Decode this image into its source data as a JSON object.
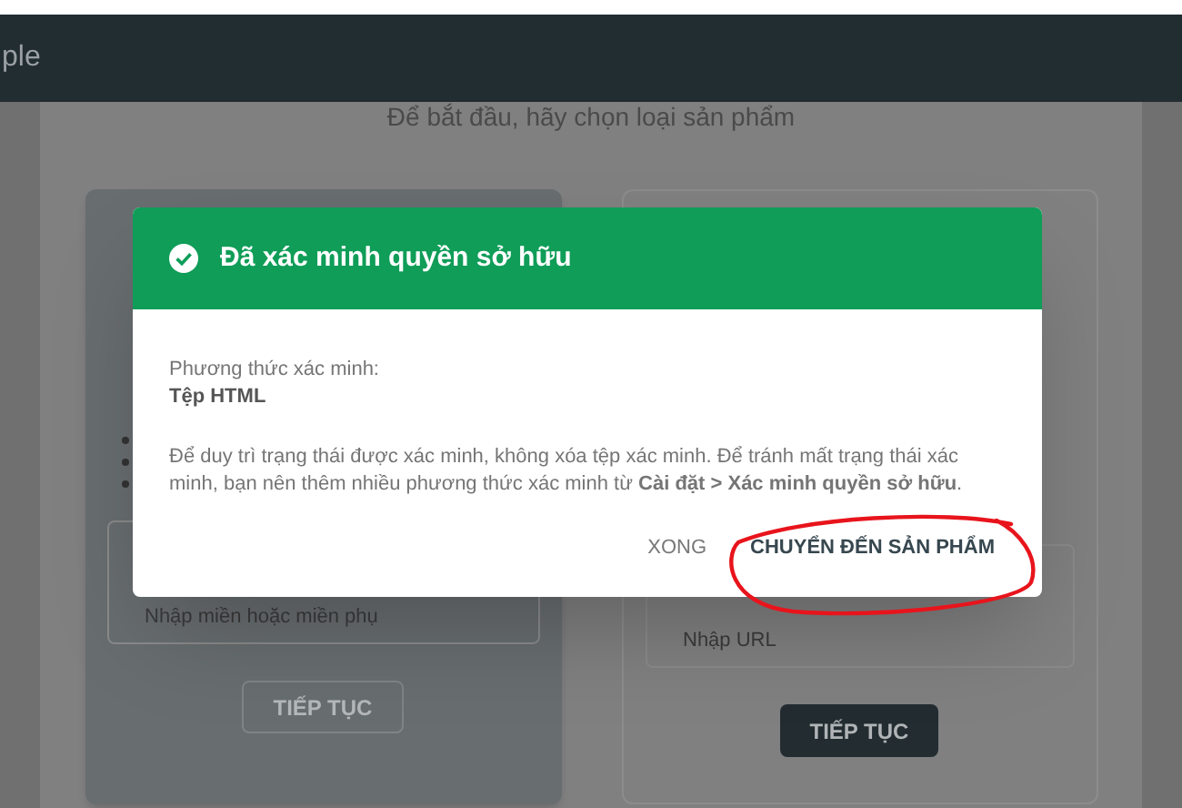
{
  "header": {
    "title": "ple"
  },
  "page": {
    "subtitle": "Để bắt đầu, hãy chọn loại sản phẩm"
  },
  "product_types": [
    {
      "selected": true,
      "placeholder": "Nhập miền hoặc miền phụ",
      "button": "TIẾP TỤC"
    },
    {
      "selected": false,
      "placeholder": "Nhập URL",
      "button": "TIẾP TỤC"
    }
  ],
  "dialog": {
    "title": "Đã xác minh quyền sở hữu",
    "method_label": "Phương thức xác minh:",
    "method": "Tệp HTML",
    "note": "Để duy trì trạng thái được xác minh, không xóa tệp xác minh. Để tránh mất trạng thái xác minh, bạn nên thêm nhiều phương thức xác minh từ **Cài đặt > Xác minh quyền sở hữu**.",
    "buttons": [
      {
        "label": "XONG",
        "kind": "text"
      },
      {
        "label": "CHUYỂN ĐẾN SẢN PHẨM",
        "kind": "primary"
      }
    ]
  }
}
